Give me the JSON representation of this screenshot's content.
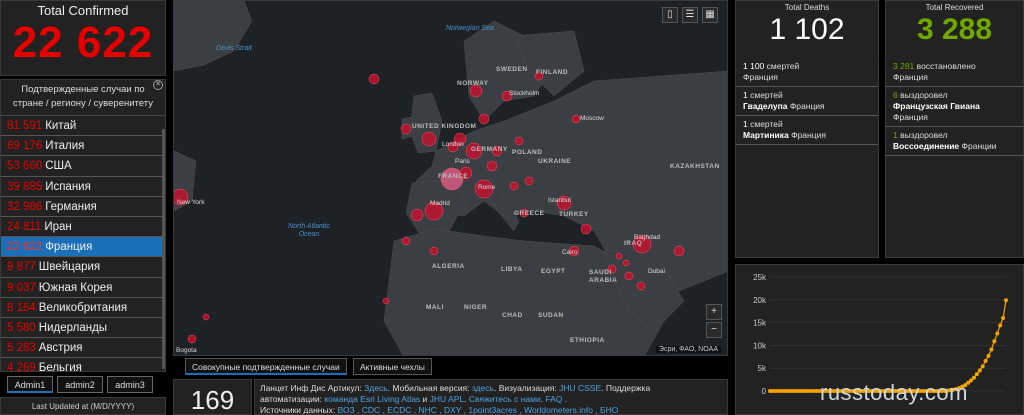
{
  "total_confirmed": {
    "title": "Total Confirmed",
    "value": "22 622"
  },
  "country_list": {
    "header": "Подтвержденные случаи по стране / региону / суверенитету",
    "rows": [
      {
        "num": "81 591",
        "name": "Китай"
      },
      {
        "num": "69 176",
        "name": "Италия"
      },
      {
        "num": "53 660",
        "name": "США"
      },
      {
        "num": "39 885",
        "name": "Испания"
      },
      {
        "num": "32 986",
        "name": "Германия"
      },
      {
        "num": "24 811",
        "name": "Иран"
      },
      {
        "num": "22 622",
        "name": "Франция"
      },
      {
        "num": "9 877",
        "name": "Швейцария"
      },
      {
        "num": "9 037",
        "name": "Южная Корея"
      },
      {
        "num": "8 164",
        "name": "Великобритания"
      },
      {
        "num": "5 580",
        "name": "Нидерланды"
      },
      {
        "num": "5 283",
        "name": "Австрия"
      },
      {
        "num": "4 269",
        "name": "Бельгия"
      }
    ],
    "selected_index": 6,
    "selected_color": "#1b6fb6"
  },
  "admin_tabs": [
    "Admin1",
    "admin2",
    "admin3"
  ],
  "last_updated": "Last Updated at (M/D/YYYY)",
  "map": {
    "labels": [
      {
        "t": "NORWAY"
      },
      {
        "t": "SWEDEN"
      },
      {
        "t": "FINLAND"
      },
      {
        "t": "UNITED KINGDOM"
      },
      {
        "t": "GERMANY"
      },
      {
        "t": "POLAND"
      },
      {
        "t": "UKRAINE"
      },
      {
        "t": "KAZAKHSTAN"
      },
      {
        "t": "FRANCE"
      },
      {
        "t": "GREECE"
      },
      {
        "t": "TURKEY"
      },
      {
        "t": "IRAQ"
      },
      {
        "t": "ALGERIA"
      },
      {
        "t": "LIBYA"
      },
      {
        "t": "EGYPT"
      },
      {
        "t": "SAUDI ARABIA"
      },
      {
        "t": "MALI"
      },
      {
        "t": "NIGER"
      },
      {
        "t": "CHAD"
      },
      {
        "t": "SUDAN"
      },
      {
        "t": "ETHIOPIA"
      }
    ],
    "cities": [
      "Moscow",
      "London",
      "Paris",
      "Madrid",
      "Istanbul",
      "Baghdad",
      "Cairo",
      "Dubai",
      "Stockholm",
      "Rome",
      "New York",
      "Bogota"
    ],
    "oceans": [
      "Davis Strait",
      "Norwegian Sea",
      "North Atlantic Ocean"
    ],
    "attribution": "Эсри, ФАО, NOAA",
    "zoom_in": "+",
    "zoom_out": "−"
  },
  "map_tabs": [
    "Совокупные подтвержденные случаи",
    "Активные чехлы"
  ],
  "countries_count": "169",
  "info": {
    "lines": [
      {
        "segments": [
          {
            "t": "Ланцет Инф Дис Артикул: "
          },
          {
            "t": "Здесь",
            "link": true
          },
          {
            "t": ". Мобильная версия: "
          },
          {
            "t": "здесь",
            "link": true
          },
          {
            "t": ". Визуализация: "
          },
          {
            "t": "JHU CSSE",
            "link": true
          },
          {
            "t": ". Поддержка"
          }
        ]
      },
      {
        "segments": [
          {
            "t": "автоматизации: "
          },
          {
            "t": "команда Esri Living Atlas",
            "link": true
          },
          {
            "t": " и "
          },
          {
            "t": "JHU APL",
            "link": true
          },
          {
            "t": ". "
          },
          {
            "t": "Свяжитесь с нами",
            "link": true
          },
          {
            "t": ". "
          },
          {
            "t": "FAQ",
            "link": true
          },
          {
            "t": " ."
          }
        ]
      },
      {
        "segments": [
          {
            "t": "Источники данных: "
          },
          {
            "t": "ВОЗ , CDC , ECDC , NHC , DXY , 1point3acres , Worldometers.info , БНО",
            "link": true
          }
        ]
      }
    ]
  },
  "deaths": {
    "title": "Total Deaths",
    "value": "1 102",
    "items": [
      {
        "num": "1 100",
        "unit": "смертей",
        "place": "",
        "region": "Франция"
      },
      {
        "num": "1",
        "unit": "смертей",
        "place": "Гваделупа",
        "region": "Франция"
      },
      {
        "num": "1",
        "unit": "смертей",
        "place": "Мартиника",
        "region": "Франция"
      }
    ]
  },
  "recovered": {
    "title": "Total Recovered",
    "value": "3 288",
    "items": [
      {
        "num": "3 281",
        "unit": "восстановлено",
        "place": "",
        "region": "Франция"
      },
      {
        "num": "6",
        "unit": "выздоровел",
        "place": "Французская Гвиана",
        "region": "Франция"
      },
      {
        "num": "1",
        "unit": "выздоровел",
        "place": "Воссоединение",
        "region": "Франции"
      }
    ]
  },
  "chart_data": {
    "type": "line",
    "title": "",
    "xlabel": "",
    "ylabel": "",
    "yticks": [
      "0",
      "5k",
      "10k",
      "15k",
      "20k",
      "25k"
    ],
    "ylim": [
      0,
      25000
    ],
    "series": [
      {
        "values": [
          0,
          0,
          0,
          0,
          0,
          0,
          0,
          0,
          0,
          0,
          0,
          0,
          0,
          0,
          0,
          0,
          0,
          0,
          0,
          0,
          0,
          0,
          0,
          0,
          0,
          0,
          0,
          0,
          0,
          0,
          0,
          0,
          0,
          0,
          0,
          0,
          0,
          0,
          0,
          0,
          0,
          0,
          0,
          0,
          0,
          0,
          0,
          0,
          0,
          0,
          0,
          0,
          0,
          0,
          0,
          0,
          0,
          0,
          0,
          0,
          0,
          100,
          200,
          290,
          420,
          650,
          950,
          1300,
          1800,
          2300,
          2900,
          3700,
          4500,
          5400,
          6600,
          7700,
          9100,
          10900,
          12600,
          14400,
          16000,
          19900
        ]
      }
    ],
    "color": "#f5a300",
    "grid": true
  },
  "watermark": "russtoday.com",
  "colors": {
    "confirmed": "#e60000",
    "recovered": "#70a800",
    "link": "#4fa3e0"
  }
}
